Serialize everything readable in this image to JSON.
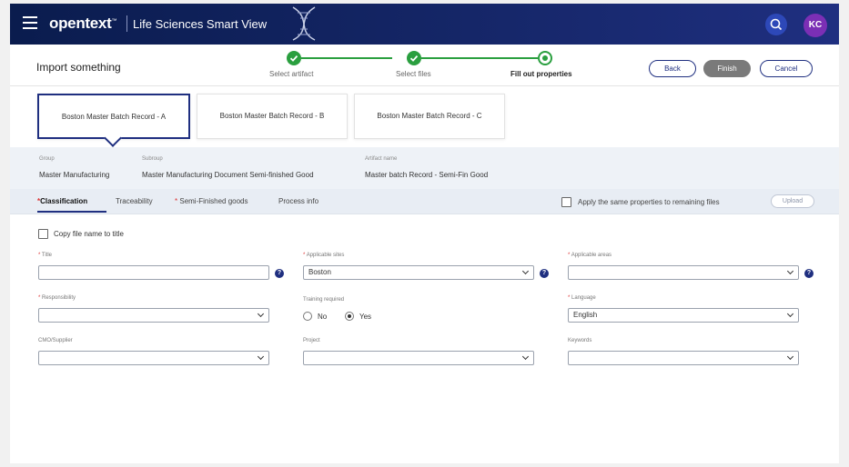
{
  "header": {
    "brand": "opentext",
    "brand_tm": "™",
    "product": "Life Sciences Smart View",
    "avatar_initials": "KC",
    "icons": [
      "menu-icon",
      "dna-icon",
      "search-icon"
    ]
  },
  "titlebar": {
    "title": "Import something",
    "steps": [
      {
        "label": "Select artifact",
        "state": "done"
      },
      {
        "label": "Select files",
        "state": "done"
      },
      {
        "label": "Fill out properties",
        "state": "current"
      }
    ],
    "back_label": "Back",
    "finish_label": "Finish",
    "cancel_label": "Cancel"
  },
  "artifacts": [
    {
      "label": "Boston Master Batch Record - A",
      "active": true
    },
    {
      "label": "Boston Master Batch Record - B",
      "active": false
    },
    {
      "label": "Boston Master Batch Record - C",
      "active": false
    }
  ],
  "meta": {
    "group_label": "Group",
    "group_value": "Master Manufacturing",
    "subgroup_label": "Subroup",
    "subgroup_value": "Master Manufacturing Document Semi-finished Good",
    "artifact_label": "Artifact name",
    "artifact_value": "Master batch Record - Semi-Fin Good"
  },
  "tabs": {
    "classification": "Classification",
    "traceability": "Traceability",
    "semi_finished": "Semi-Finished goods",
    "process_info": "Process info",
    "required_mark": "*",
    "apply_same": "Apply the same properties to remaining files",
    "upload": "Upload"
  },
  "form": {
    "copy_filename": "Copy file name to title",
    "title_label": "Title",
    "title_value": "",
    "sites_label": "Applicable sites",
    "sites_value": "Boston",
    "areas_label": "Applicable areas",
    "areas_value": "",
    "responsibility_label": "Responsibility",
    "responsibility_value": "",
    "training_label": "Training required",
    "training_no": "No",
    "training_yes": "Yes",
    "language_label": "Language",
    "language_value": "English",
    "cmo_label": "CMO/Supplier",
    "cmo_value": "",
    "project_label": "Project",
    "project_value": "",
    "keywords_label": "Keywords",
    "keywords_value": "",
    "help_glyph": "?"
  },
  "colors": {
    "header_dark": "#0a1c4e",
    "primary": "#1f2f80",
    "success": "#2a9f3f",
    "avatar": "#7b2fb5",
    "required": "#dd3333"
  }
}
